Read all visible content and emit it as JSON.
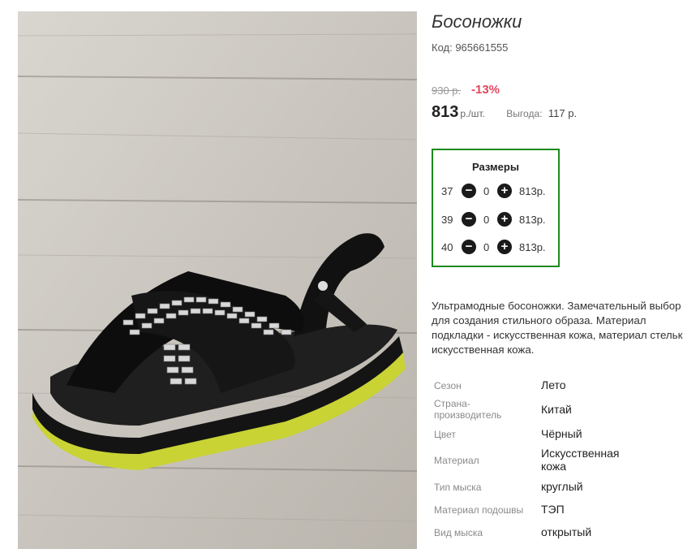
{
  "product": {
    "title": "Босоножки",
    "code": "Код: 965661555",
    "old_price": "930 р.",
    "discount": "-13%",
    "price": "813",
    "price_unit": "р./шт.",
    "benefit_label": "Выгода:",
    "benefit_value": "117 р.",
    "description": "Ультрамодные босоножки. Замечательный выбор для создания стильного образа. Материал подкладки - искусственная кожа, материал стельки - искусственная кожа."
  },
  "sizes": {
    "title": "Размеры",
    "minus_icon": "−",
    "plus_icon": "+",
    "rows": [
      {
        "size": "37",
        "qty": "0",
        "price": "813р."
      },
      {
        "size": "39",
        "qty": "0",
        "price": "813р."
      },
      {
        "size": "40",
        "qty": "0",
        "price": "813р."
      }
    ]
  },
  "specs": [
    {
      "key": "Сезон",
      "value": "Лето"
    },
    {
      "key": "Страна-производитель",
      "value": "Китай"
    },
    {
      "key": "Цвет",
      "value": "Чёрный"
    },
    {
      "key": "Материал",
      "value": "Искусственная кожа"
    },
    {
      "key": "Тип мыска",
      "value": "круглый"
    },
    {
      "key": "Материал подошвы",
      "value": "ТЭП"
    },
    {
      "key": "Вид мыска",
      "value": "открытый"
    }
  ],
  "colors": {
    "accent_border": "#1c8a1c",
    "discount": "#e2465f",
    "sole": "#c9d334"
  }
}
